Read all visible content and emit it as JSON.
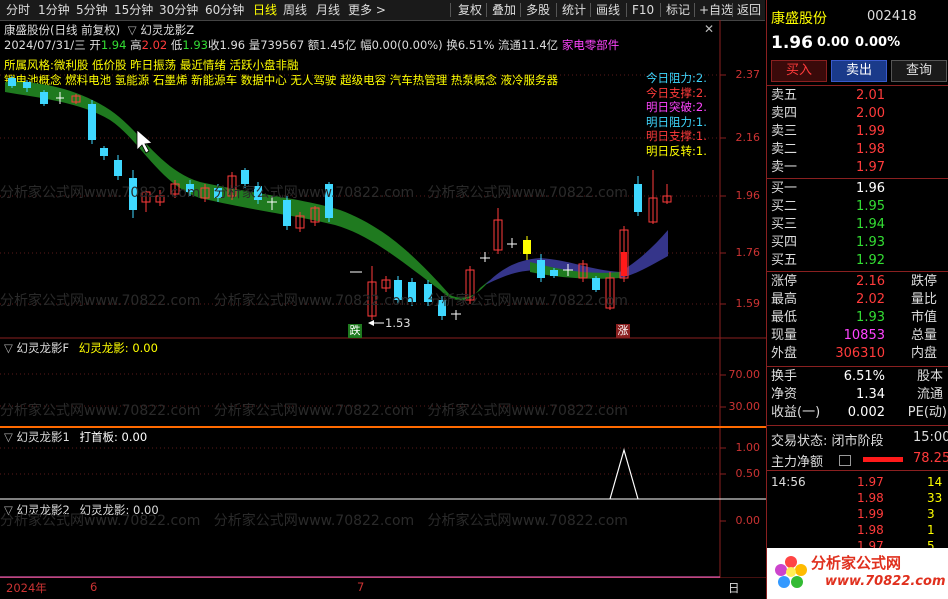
{
  "toolbar": {
    "items": [
      "分时",
      "1分钟",
      "5分钟",
      "15分钟",
      "30分钟",
      "60分钟",
      "日线",
      "周线",
      "月线",
      "更多 >"
    ],
    "right_items": [
      "复权",
      "叠加",
      "多股",
      "统计",
      "画线",
      "F10",
      "标记",
      "+自选",
      "返回"
    ]
  },
  "chart": {
    "title": "康盛股份(日线 前复权)",
    "indicator": "幻灵龙影Z",
    "date": "2024/07/31/三",
    "open_label": "开",
    "open": "1.94",
    "high_label": "高",
    "high": "2.02",
    "low_label": "低",
    "low": "1.93",
    "close_label": "收",
    "close": "1.96",
    "vol_label": "量",
    "vol": "739567",
    "amount_label": "额",
    "amount": "1.45亿",
    "amp_label": "幅",
    "amp": "0.00(0.00%)",
    "turnover_label": "换",
    "turnover": "6.51%",
    "float_label": "流通",
    "float": "11.4亿",
    "sector": "家电零部件",
    "concepts_line1": "所属风格:",
    "concepts_line1b": "微利股 低价股 昨日振荡 最近情绪 活跃小盘非融",
    "concepts_line2": "锂电池概念 燃料电池 氢能源 石墨烯 新能源车 数据中心 无人驾驶 超级电容 汽车热管理 热泵概念 液冷服务器",
    "levels": [
      {
        "label": "今日阻力:",
        "value": "2.",
        "color": "#3fd8ff"
      },
      {
        "label": "今日支撑:",
        "value": "2.",
        "color": "#ff3b3b"
      },
      {
        "label": "明日突破:",
        "value": "2.",
        "color": "#ff44ff"
      },
      {
        "label": "明日阻力:",
        "value": "1.",
        "color": "#3fd8ff"
      },
      {
        "label": "明日支撑:",
        "value": "1.",
        "color": "#ff3b3b"
      },
      {
        "label": "明日反转:",
        "value": "1.",
        "color": "#ffff00"
      }
    ],
    "yaxis": [
      "2.37",
      "2.16",
      "1.96",
      "1.76",
      "1.59"
    ],
    "low_marker": "1.53",
    "badge_down": "跌",
    "badge_up": "涨"
  },
  "panels": {
    "p1_name": "幻灵龙影F",
    "p1_text": "幻灵龙影: 0.00",
    "p1_axis": [
      "70.00",
      "30.00"
    ],
    "p2_name": "幻灵龙影1",
    "p2_text": "打首板: 0.00",
    "p2_axis": [
      "1.00",
      "0.50"
    ],
    "p3_name": "幻灵龙影2",
    "p3_text": "幻灵龙影: 0.00",
    "p3_axis": [
      "0.00"
    ]
  },
  "timeline": {
    "year": "2024年",
    "m6": "6",
    "m7": "7",
    "end": "日"
  },
  "watermark": "分析家公式网www.70822.com",
  "quote": {
    "name": "康盛股份",
    "code": "002418",
    "price": "1.96",
    "change": "0.00",
    "pct": "0.00%",
    "buy_btn": "买入",
    "sell_btn": "卖出",
    "query_btn": "查询",
    "asks": [
      {
        "label": "卖五",
        "price": "2.01"
      },
      {
        "label": "卖四",
        "price": "2.00"
      },
      {
        "label": "卖三",
        "price": "1.99"
      },
      {
        "label": "卖二",
        "price": "1.98"
      },
      {
        "label": "卖一",
        "price": "1.97"
      }
    ],
    "bids": [
      {
        "label": "买一",
        "price": "1.96",
        "color": "#ffffff"
      },
      {
        "label": "买二",
        "price": "1.95",
        "color": "#33dd33"
      },
      {
        "label": "买三",
        "price": "1.94",
        "color": "#33dd33"
      },
      {
        "label": "买四",
        "price": "1.93",
        "color": "#33dd33"
      },
      {
        "label": "买五",
        "price": "1.92",
        "color": "#33dd33"
      }
    ],
    "stats": [
      {
        "l": "涨停",
        "v": "2.16",
        "c": "#ff3b3b",
        "r": "跌停"
      },
      {
        "l": "最高",
        "v": "2.02",
        "c": "#ff3b3b",
        "r": "量比"
      },
      {
        "l": "最低",
        "v": "1.93",
        "c": "#33dd33",
        "r": "市值"
      },
      {
        "l": "现量",
        "v": "10853",
        "c": "#ff44ff",
        "r": "总量"
      },
      {
        "l": "外盘",
        "v": "306310",
        "c": "#ff3b3b",
        "r": "内盘"
      }
    ],
    "stats2": [
      {
        "l": "换手",
        "v": "6.51%",
        "r": "股本"
      },
      {
        "l": "净资",
        "v": "1.34",
        "r": "流通"
      },
      {
        "l": "收益(一)",
        "v": "0.002",
        "r": "PE(动)"
      }
    ],
    "trade_state": "交易状态: 闭市阶段",
    "trade_time": "15:00",
    "main_flow_label": "主力净额",
    "main_flow_value": "78.25",
    "ticks": [
      {
        "time": "14:56",
        "price": "1.97",
        "vol": "14"
      },
      {
        "time": "",
        "price": "1.98",
        "vol": "33"
      },
      {
        "time": "",
        "price": "1.99",
        "vol": "3"
      },
      {
        "time": "",
        "price": "1.98",
        "vol": "1"
      },
      {
        "time": "",
        "price": "1.97",
        "vol": "5"
      }
    ],
    "logo_text": "分析家公式网",
    "logo_url": "www.70822.com"
  }
}
